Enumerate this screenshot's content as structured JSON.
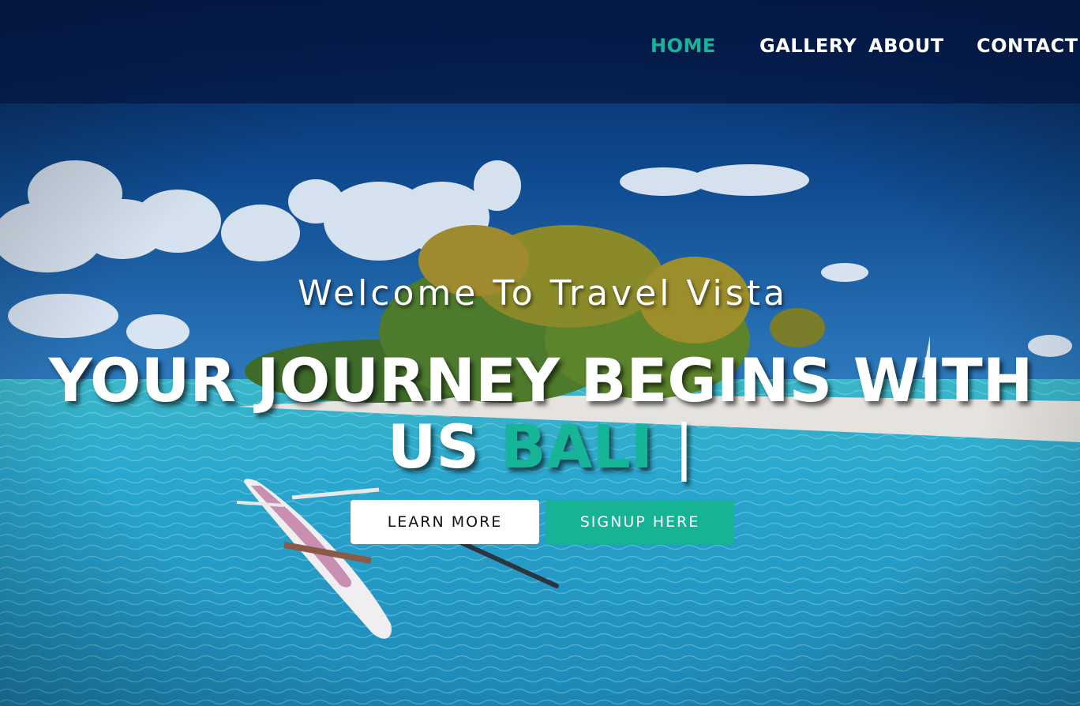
{
  "page": {
    "title": "Travel Vista"
  },
  "nav": {
    "items": [
      {
        "label": "HOME",
        "active": true
      },
      {
        "label": "GALLERY",
        "active": false
      },
      {
        "label": "ABOUT",
        "active": false
      },
      {
        "label": "CONTACT",
        "active": false
      }
    ]
  },
  "hero": {
    "welcome": "Welcome To Travel Vista",
    "headline_main": "YOUR JOURNEY BEGINS WITH US",
    "headline_accent": "BALI",
    "headline_cursor": "|",
    "background": "tropical-island-lagoon-with-outrigger-canoe",
    "buttons": {
      "learn_more": "LEARN MORE",
      "signup": "SIGNUP HERE"
    }
  },
  "colors": {
    "accent": "#17b597",
    "nav_bg": "#04163f",
    "sky": "#0c3f86",
    "water": "#2a9cc4",
    "text": "#ffffff"
  }
}
